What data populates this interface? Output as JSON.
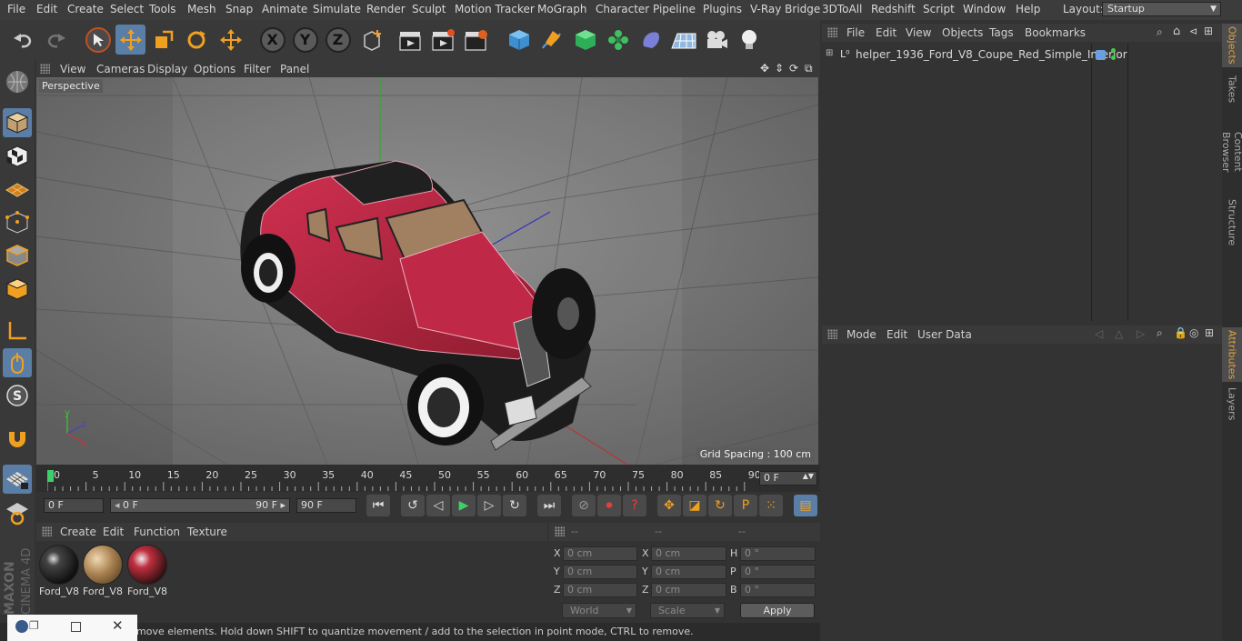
{
  "menu": [
    "File",
    "Edit",
    "Create",
    "Select",
    "Tools",
    "Mesh",
    "Snap",
    "Animate",
    "Simulate",
    "Render",
    "Sculpt",
    "Motion Tracker",
    "MoGraph",
    "Character",
    "Pipeline",
    "Plugins",
    "V-Ray Bridge",
    "3DToAll",
    "Redshift",
    "Script",
    "Window",
    "Help"
  ],
  "layout": {
    "label": "Layout:",
    "value": "Startup"
  },
  "toolbar": {
    "x": "X",
    "y": "Y",
    "z": "Z"
  },
  "viewport_menu": [
    "View",
    "Cameras",
    "Display",
    "Options",
    "Filter",
    "Panel"
  ],
  "viewport": {
    "label": "Perspective",
    "grid": "Grid Spacing : 100 cm",
    "axis_x": "x",
    "axis_y": "y",
    "axis_z": "z"
  },
  "timeline": {
    "ticks": [
      "0",
      "5",
      "10",
      "15",
      "20",
      "25",
      "30",
      "35",
      "40",
      "45",
      "50",
      "55",
      "60",
      "65",
      "70",
      "75",
      "80",
      "85",
      "90"
    ],
    "current_frame": "0 F"
  },
  "transport": {
    "start": "0 F",
    "range_start": "0 F",
    "range_end": "90 F",
    "end": "90 F",
    "p": "P"
  },
  "material_menu": [
    "Create",
    "Edit",
    "Function",
    "Texture"
  ],
  "materials": [
    {
      "label": "Ford_V8",
      "kind": "dark"
    },
    {
      "label": "Ford_V8",
      "kind": "tan"
    },
    {
      "label": "Ford_V8",
      "kind": "red"
    }
  ],
  "coords": {
    "headers": [
      "--",
      "--",
      "--"
    ],
    "rows": [
      {
        "a1": "X",
        "v1": "0 cm",
        "a2": "X",
        "v2": "0 cm",
        "a3": "H",
        "v3": "0 °"
      },
      {
        "a1": "Y",
        "v1": "0 cm",
        "a2": "Y",
        "v2": "0 cm",
        "a3": "P",
        "v3": "0 °"
      },
      {
        "a1": "Z",
        "v1": "0 cm",
        "a2": "Z",
        "v2": "0 cm",
        "a3": "B",
        "v3": "0 °"
      }
    ],
    "world": "World",
    "scale": "Scale",
    "apply": "Apply"
  },
  "status": "move elements. Hold down SHIFT to quantize movement / add to the selection in point mode, CTRL to remove.",
  "object_menu": [
    "File",
    "Edit",
    "View",
    "Objects",
    "Tags",
    "Bookmarks"
  ],
  "object": {
    "name": "helper_1936_Ford_V8_Coupe_Red_Simple_Interior"
  },
  "attr_menu": [
    "Mode",
    "Edit",
    "User Data"
  ],
  "vtabs": [
    "Objects",
    "Takes",
    "Content Browser",
    "Structure",
    "Attributes",
    "Layers"
  ],
  "branding": {
    "maxon": "MAXON",
    "cinema": "CINEMA 4D"
  }
}
